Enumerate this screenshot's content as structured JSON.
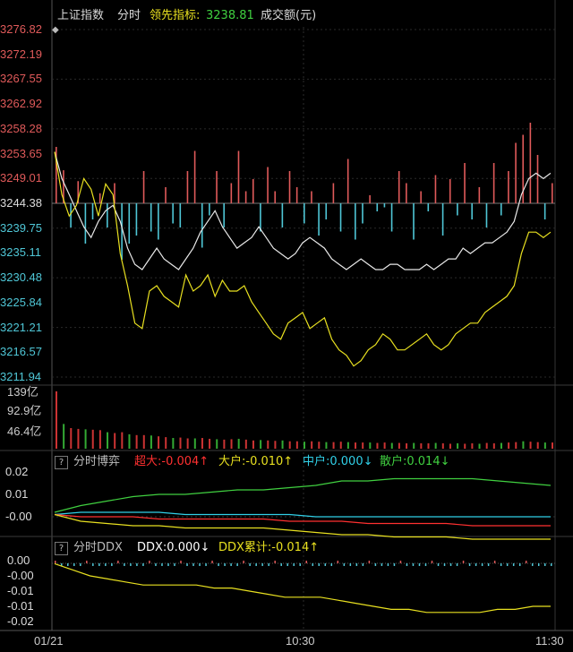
{
  "colors": {
    "background": "#000000",
    "up": "#e05a5a",
    "down": "#4fc6d6",
    "index_line": "#e8e8e8",
    "leading_line": "#e8e020",
    "volume_up": "#cc3333",
    "volume_down": "#33aa33",
    "super_large": "#ff3030",
    "large": "#e8e020",
    "medium": "#30d0e8",
    "retail": "#40d040",
    "ddx": "#ffffff",
    "ddx_cum": "#e8e020",
    "grid": "#2a2a2a"
  },
  "header": {
    "index_name": "上证指数",
    "mode": "分时",
    "leading_label": "领先指标:",
    "leading_value": "3238.81",
    "volume_label": "成交额(元)"
  },
  "price_axis": {
    "ticks": [
      "3276.82",
      "3272.19",
      "3267.55",
      "3262.92",
      "3258.28",
      "3253.65",
      "3249.01",
      "3244.38",
      "3239.75",
      "3235.11",
      "3230.48",
      "3225.84",
      "3221.21",
      "3216.57",
      "3211.94"
    ],
    "prev_close": "3244.38"
  },
  "volume_axis": {
    "ticks": [
      "139亿",
      "92.9亿",
      "46.4亿"
    ]
  },
  "game_panel": {
    "help": "?",
    "title": "分时博弈",
    "super": "超大:-0.004↑",
    "large": "大户:-0.010↑",
    "medium": "中户:0.000↓",
    "retail": "散户:0.014↓",
    "ticks": [
      "0.02",
      "0.01",
      "-0.00"
    ]
  },
  "ddx_panel": {
    "help": "?",
    "title": "分时DDX",
    "ddx": "DDX:0.000↓",
    "ddx_cum": "DDX累计:-0.014↑",
    "ticks": [
      "0.00",
      "-0.00",
      "-0.01",
      "-0.01",
      "-0.02"
    ]
  },
  "time_axis": [
    "01/21",
    "10:30",
    "11:30"
  ],
  "chart_data": {
    "type": "line",
    "xlabel": "",
    "ylabel": "",
    "ylim": [
      3211.94,
      3276.82
    ],
    "prev_close": 3244.38,
    "x_range": [
      "09:30",
      "11:30"
    ],
    "series": [
      {
        "values": [
          3254,
          3249,
          3246,
          3243,
          3240,
          3238,
          3241,
          3243,
          3244,
          3241,
          3236,
          3233,
          3232,
          3234,
          3236,
          3234,
          3233,
          3232,
          3234,
          3236,
          3239,
          3241,
          3243,
          3240,
          3238,
          3236,
          3237,
          3238,
          3240,
          3238,
          3236,
          3235,
          3234,
          3235,
          3237,
          3238,
          3237,
          3236,
          3234,
          3233,
          3232,
          3233,
          3234,
          3233,
          3232,
          3232,
          3233,
          3233,
          3232,
          3232,
          3232,
          3233,
          3232,
          3233,
          3234,
          3234,
          3236,
          3235,
          3236,
          3237,
          3237,
          3238,
          3239,
          3241,
          3246,
          3249,
          3250,
          3249,
          3250
        ]
      },
      {
        "values": [
          3254,
          3246,
          3242,
          3244,
          3249,
          3247,
          3242,
          3248,
          3246,
          3235,
          3229,
          3222,
          3221,
          3228,
          3229,
          3227,
          3226,
          3225,
          3231,
          3228,
          3229,
          3231,
          3227,
          3230,
          3228,
          3228,
          3229,
          3226,
          3224,
          3222,
          3220,
          3219,
          3222,
          3223,
          3224,
          3221,
          3222,
          3223,
          3219,
          3217,
          3216,
          3214,
          3215,
          3217,
          3218,
          3220,
          3219,
          3217,
          3217,
          3218,
          3219,
          3220,
          3218,
          3217,
          3218,
          3220,
          3221,
          3222,
          3222,
          3224,
          3225,
          3226,
          3227,
          3229,
          3235,
          3239,
          3239,
          3238,
          3239
        ]
      }
    ],
    "vol_bars": [
      1.4,
      0.82,
      -0.6,
      0.55,
      -1.0,
      -0.4,
      0.25,
      -0.6,
      0.5,
      -1.4,
      -1.0,
      -0.8,
      0.8,
      -0.7,
      -0.9,
      0.4,
      -0.5,
      -0.6,
      0.8,
      1.3,
      -1.1,
      -0.3,
      0.8,
      -0.6,
      0.5,
      1.3,
      0.3,
      0.6,
      -0.7,
      0.9,
      0.3,
      -0.6,
      0.8,
      0.4,
      -0.5,
      0.3,
      -0.8,
      -0.4,
      0.5,
      -0.7,
      1.1,
      -0.9,
      -0.5,
      0.2,
      -0.2,
      -0.1,
      -0.7,
      0.8,
      0.5,
      -0.9,
      0.3,
      -0.2,
      0.7,
      -0.8,
      0.6,
      -0.3,
      1.0,
      -0.4,
      0.4,
      -0.6,
      1.0,
      -0.3,
      0.8,
      1.5,
      1.7,
      2.0,
      1.2,
      -0.4,
      0.5
    ],
    "amounts": [
      139,
      60,
      50,
      48,
      47,
      46,
      45,
      40,
      38,
      40,
      35,
      33,
      33,
      32,
      30,
      28,
      26,
      27,
      25,
      25,
      26,
      24,
      23,
      22,
      23,
      24,
      22,
      20,
      21,
      20,
      19,
      20,
      18,
      18,
      17,
      18,
      17,
      16,
      16,
      17,
      16,
      15,
      15,
      15,
      14,
      15,
      14,
      14,
      13,
      14,
      13,
      13,
      14,
      13,
      12,
      13,
      12,
      13,
      12,
      14,
      13,
      14,
      15,
      16,
      18,
      17,
      16,
      15,
      15
    ],
    "game_super": [
      0.001,
      0.0,
      0.0,
      0.0,
      -0.001,
      -0.001,
      -0.001,
      -0.001,
      -0.001,
      -0.002,
      -0.002,
      -0.002,
      -0.003,
      -0.003,
      -0.003,
      -0.003,
      -0.004,
      -0.004,
      -0.004,
      -0.004
    ],
    "game_large": [
      0.001,
      -0.002,
      -0.003,
      -0.004,
      -0.004,
      -0.005,
      -0.005,
      -0.005,
      -0.005,
      -0.006,
      -0.007,
      -0.008,
      -0.008,
      -0.009,
      -0.009,
      -0.009,
      -0.01,
      -0.01,
      -0.01,
      -0.01
    ],
    "game_medium": [
      0.001,
      0.002,
      0.002,
      0.002,
      0.002,
      0.001,
      0.001,
      0.001,
      0.001,
      0.001,
      0.0,
      0.0,
      0.0,
      0.0,
      0.0,
      0.0,
      0.0,
      0.0,
      0.0,
      0.0
    ],
    "game_retail": [
      0.002,
      0.005,
      0.007,
      0.009,
      0.01,
      0.01,
      0.011,
      0.012,
      0.012,
      0.013,
      0.014,
      0.016,
      0.016,
      0.017,
      0.017,
      0.017,
      0.017,
      0.016,
      0.015,
      0.014
    ],
    "ddx_cum": [
      -0.001,
      -0.003,
      -0.005,
      -0.006,
      -0.007,
      -0.008,
      -0.008,
      -0.008,
      -0.008,
      -0.009,
      -0.009,
      -0.01,
      -0.011,
      -0.012,
      -0.012,
      -0.012,
      -0.013,
      -0.014,
      -0.015,
      -0.016,
      -0.016,
      -0.017,
      -0.017,
      -0.017,
      -0.017,
      -0.016,
      -0.016,
      -0.015,
      -0.015
    ]
  }
}
